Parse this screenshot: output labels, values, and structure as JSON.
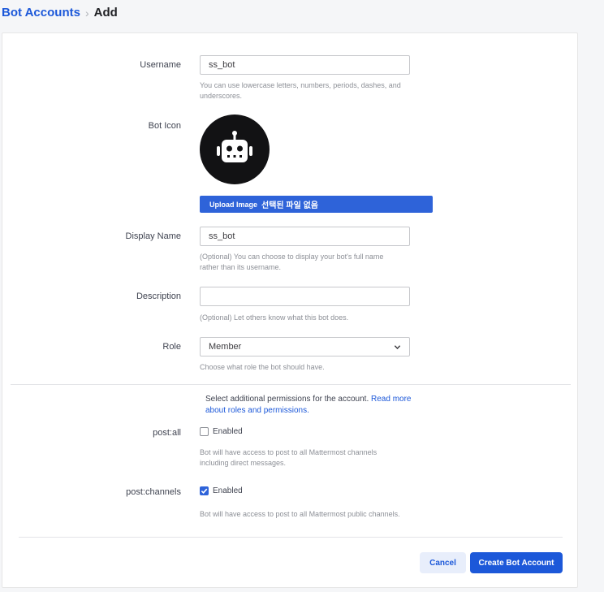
{
  "breadcrumb": {
    "parent": "Bot Accounts",
    "separator": "›",
    "current": "Add"
  },
  "form": {
    "username": {
      "label": "Username",
      "value": "ss_bot",
      "help": "You can use lowercase letters, numbers, periods, dashes, and underscores."
    },
    "bot_icon": {
      "label": "Bot Icon",
      "icon": "robot-icon",
      "upload_label": "Upload Image",
      "file_status": "선택된 파일 없음"
    },
    "display_name": {
      "label": "Display Name",
      "value": "ss_bot",
      "help": "(Optional) You can choose to display your bot's full name rather than its username."
    },
    "description": {
      "label": "Description",
      "value": "",
      "help": "(Optional) Let others know what this bot does."
    },
    "role": {
      "label": "Role",
      "value": "Member",
      "help": "Choose what role the bot should have."
    }
  },
  "permissions": {
    "intro": "Select additional permissions for the account.",
    "link": "Read more about roles and permissions.",
    "post_all": {
      "label": "post:all",
      "checkbox_label": "Enabled",
      "checked": false,
      "help": "Bot will have access to post to all Mattermost channels including direct messages."
    },
    "post_channels": {
      "label": "post:channels",
      "checkbox_label": "Enabled",
      "checked": true,
      "help": "Bot will have access to post to all Mattermost public channels."
    }
  },
  "actions": {
    "cancel": "Cancel",
    "create": "Create Bot Account"
  },
  "colors": {
    "primary": "#1c58d9",
    "upload_button": "#2e63d9",
    "avatar_bg": "#121214"
  }
}
